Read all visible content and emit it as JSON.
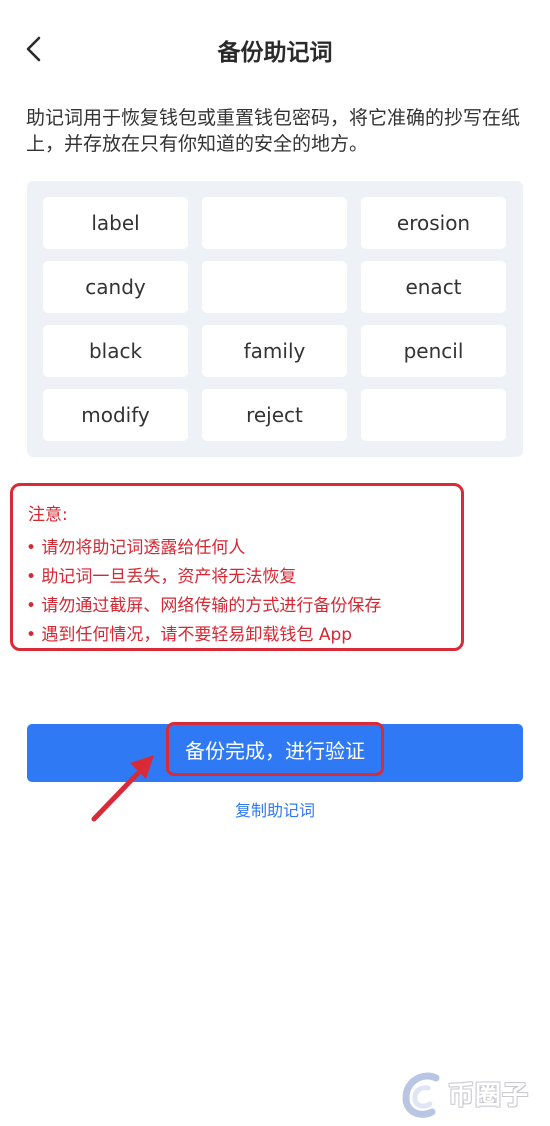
{
  "header": {
    "title": "备份助记词",
    "back_icon": "chevron-left-icon"
  },
  "description": "助记词用于恢复钱包或重置钱包密码，将它准确的抄写在纸上，并存放在只有你知道的安全的地方。",
  "mnemonic": {
    "words": [
      "label",
      "",
      "erosion",
      "candy",
      "",
      "enact",
      "black",
      "family",
      "pencil",
      "modify",
      "reject",
      ""
    ]
  },
  "notice": {
    "title": "注意:",
    "items": [
      "• 请勿将助记词透露给任何人",
      "• 助记词一旦丢失，资产将无法恢复",
      "• 请勿通过截屏、网络传输的方式进行备份保存",
      "• 遇到任何情况，请不要轻易卸载钱包 App"
    ]
  },
  "actions": {
    "primary_label": "备份完成，进行验证",
    "copy_label": "复制助记词"
  },
  "watermark": {
    "text": "币圈子"
  },
  "colors": {
    "accent": "#2f7af4",
    "warning": "#d42833",
    "panel_bg": "#eef1f6"
  }
}
